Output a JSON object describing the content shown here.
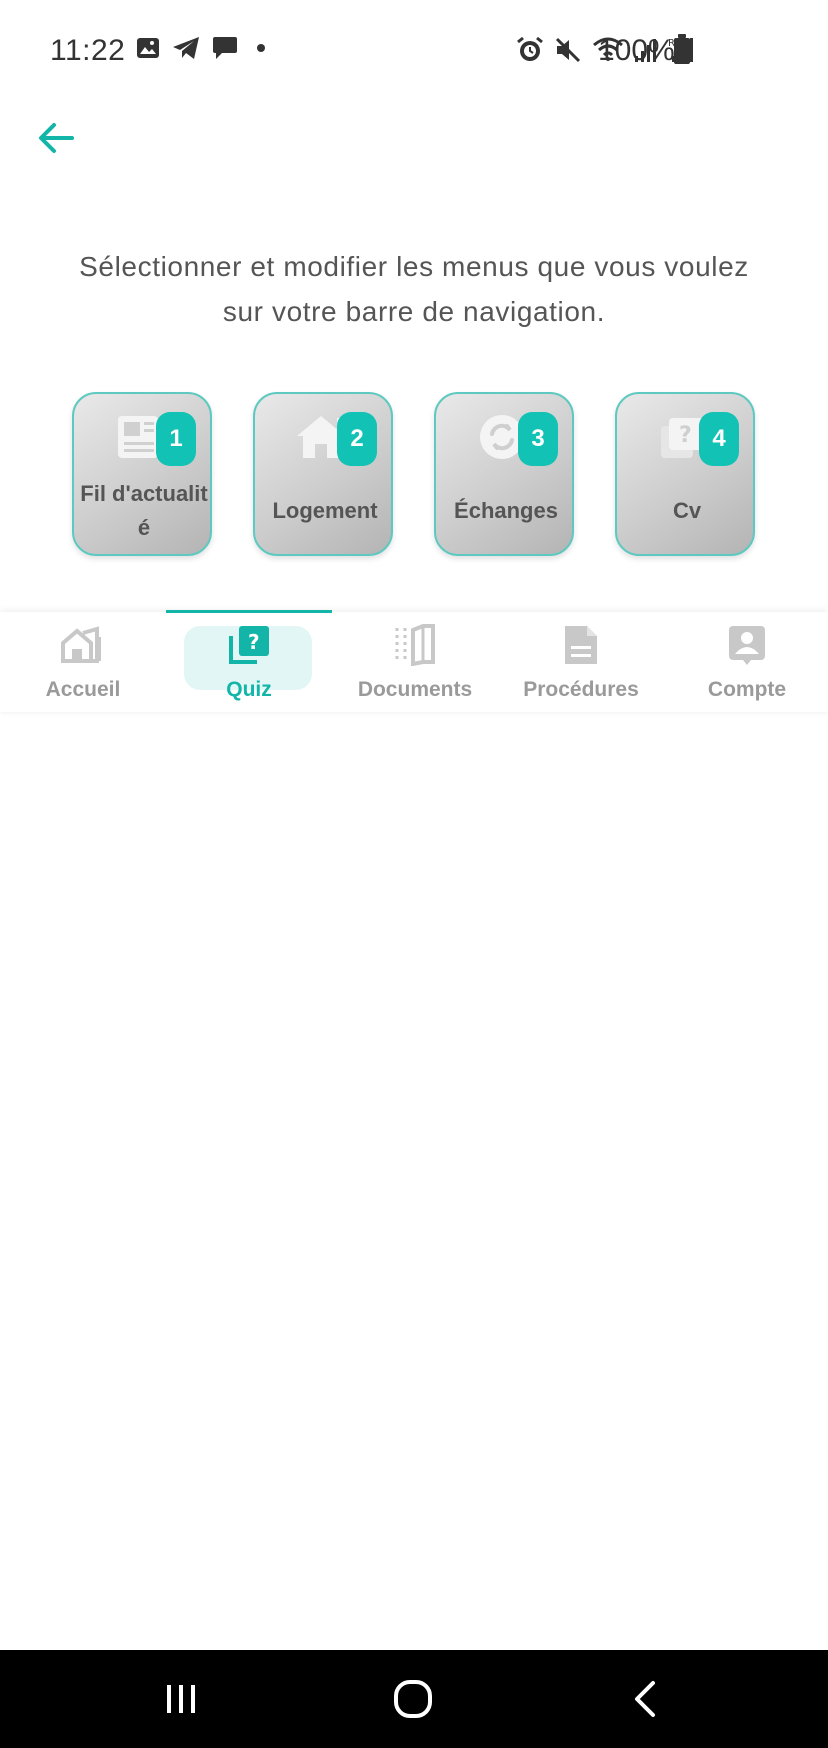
{
  "status_bar": {
    "time": "11:22",
    "battery": "100%",
    "left_icons": [
      "image-icon",
      "telegram-icon",
      "chat-icon",
      "dot-icon"
    ],
    "right_icons": [
      "alarm-icon",
      "mute-icon",
      "wifi-icon",
      "signal-icon",
      "roaming-signal-icon",
      "battery-icon"
    ]
  },
  "header": {
    "back_icon": "arrow-left-icon"
  },
  "instruction": "Sélectionner et modifier les menus que vous voulez sur votre barre de navigation.",
  "tiles": [
    {
      "number": "1",
      "label": "Fil d'actualité",
      "icon": "newspaper-icon"
    },
    {
      "number": "2",
      "label": "Logement",
      "icon": "house-icon"
    },
    {
      "number": "3",
      "label": "Échanges",
      "icon": "exchange-icon"
    },
    {
      "number": "4",
      "label": "Cv",
      "icon": "quiz-icon"
    }
  ],
  "nav": {
    "items": [
      {
        "label": "Accueil",
        "icon": "home-icon",
        "active": false
      },
      {
        "label": "Quiz",
        "icon": "quiz-icon",
        "active": true
      },
      {
        "label": "Documents",
        "icon": "documents-icon",
        "active": false
      },
      {
        "label": "Procédures",
        "icon": "procedure-icon",
        "active": false
      },
      {
        "label": "Compte",
        "icon": "account-icon",
        "active": false
      }
    ]
  },
  "colors": {
    "accent": "#12b5a8",
    "badge": "#12c2b4",
    "tile_border": "#5ec9c0",
    "inactive": "#9a9a9a",
    "text": "#555555"
  }
}
